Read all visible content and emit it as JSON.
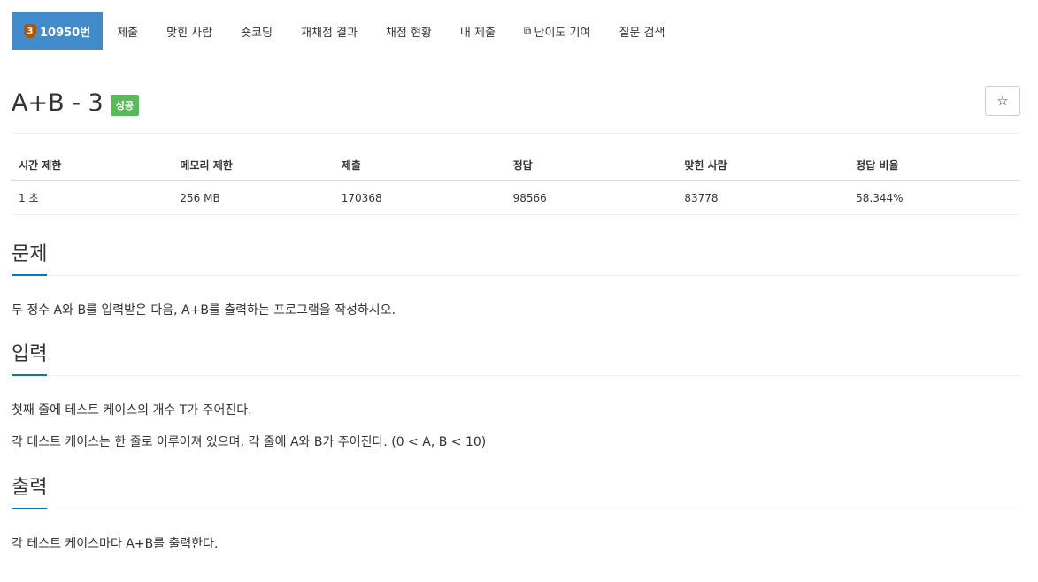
{
  "nav": {
    "problem_label": "10950번",
    "tier_number": "3",
    "items": [
      "제출",
      "맞힌 사람",
      "숏코딩",
      "재채점 결과",
      "채점 현황",
      "내 제출",
      "난이도 기여",
      "질문 검색"
    ]
  },
  "problem": {
    "title": "A+B - 3",
    "result_badge": "성공",
    "star_icon": "☆"
  },
  "info_table": {
    "headers": [
      "시간 제한",
      "메모리 제한",
      "제출",
      "정답",
      "맞힌 사람",
      "정답 비율"
    ],
    "values": [
      "1 초",
      "256 MB",
      "170368",
      "98566",
      "83778",
      "58.344%"
    ]
  },
  "sections": {
    "description": {
      "heading": "문제",
      "text": "두 정수 A와 B를 입력받은 다음, A+B를 출력하는 프로그램을 작성하시오."
    },
    "input": {
      "heading": "입력",
      "lines": [
        "첫째 줄에 테스트 케이스의 개수 T가 주어진다.",
        "각 테스트 케이스는 한 줄로 이루어져 있으며, 각 줄에 A와 B가 주어진다. (0 < A, B < 10)"
      ]
    },
    "output": {
      "heading": "출력",
      "text": "각 테스트 케이스마다 A+B를 출력한다."
    }
  },
  "colors": {
    "nav_active": "#428bca",
    "tier_badge": "#ad5600",
    "success_badge": "#5cb85c",
    "section_accent": "#0076c0"
  }
}
